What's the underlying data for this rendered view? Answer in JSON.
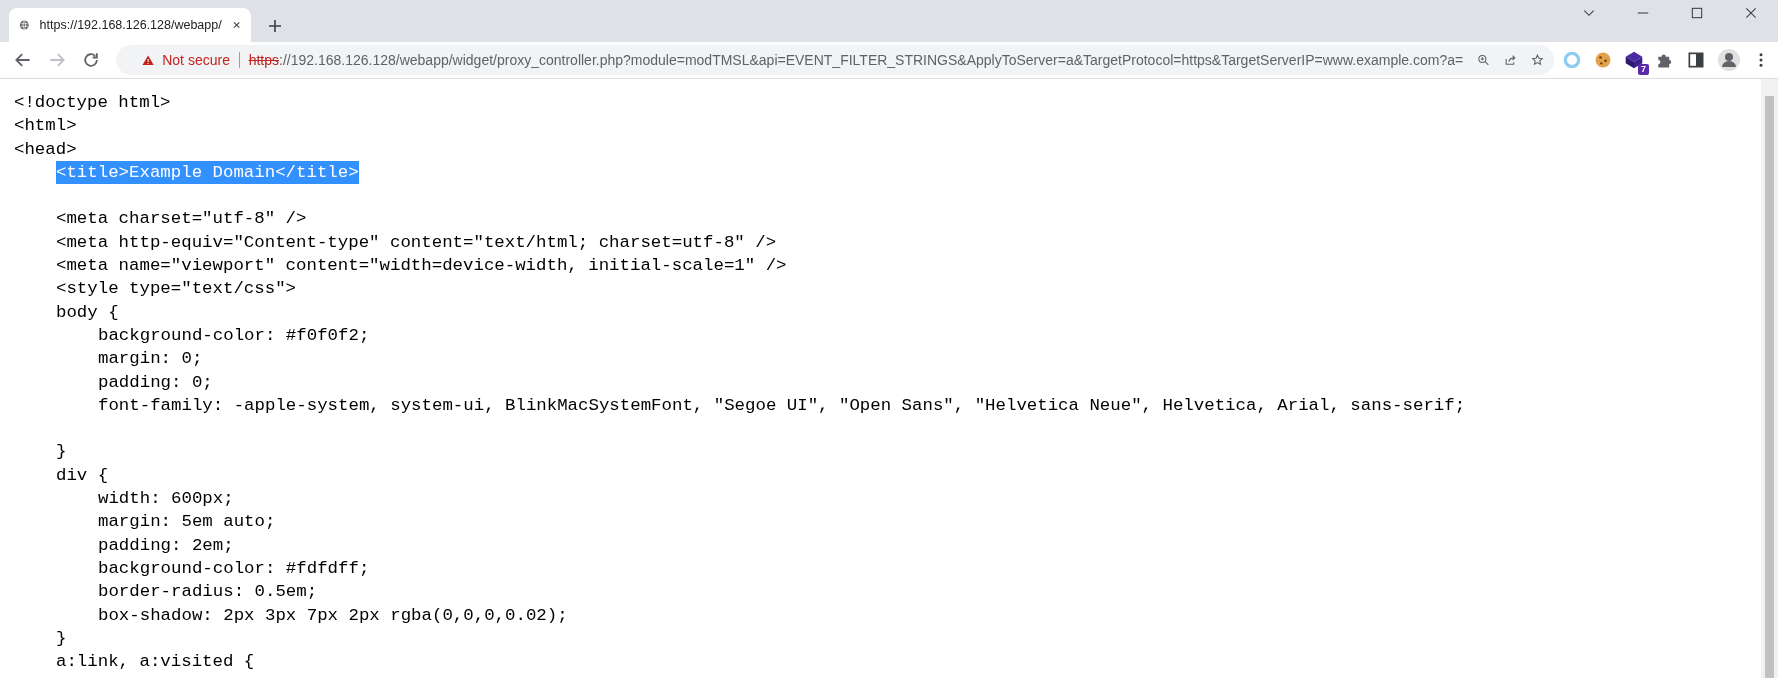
{
  "tab": {
    "title": "https://192.168.126.128/webapp/",
    "selected": true
  },
  "toolbar": {
    "forward_disabled": true
  },
  "address": {
    "security": "Not secure",
    "scheme": "https",
    "rest": "://192.168.126.128/webapp/widget/proxy_controller.php?module=modTMSL&api=EVENT_FILTER_STRINGS&ApplyToServer=a&TargetProtocol=https&TargetServerIP=www.example.com?a="
  },
  "extensions": {
    "badge": "7"
  },
  "source_lines": [
    {
      "kind": "code",
      "text": "<!doctype html>",
      "highlighted": false
    },
    {
      "kind": "code",
      "text": "<html>",
      "highlighted": false
    },
    {
      "kind": "code",
      "text": "<head>",
      "highlighted": false,
      "children": [
        {
          "kind": "code",
          "text": "<title>Example Domain</title>",
          "highlighted": true
        },
        {
          "kind": "blank"
        },
        {
          "kind": "code",
          "text": "<meta charset=\"utf-8\" />",
          "highlighted": false
        },
        {
          "kind": "code",
          "text": "<meta http-equiv=\"Content-type\" content=\"text/html; charset=utf-8\" />",
          "highlighted": false
        },
        {
          "kind": "code",
          "text": "<meta name=\"viewport\" content=\"width=device-width, initial-scale=1\" />",
          "highlighted": false
        },
        {
          "kind": "code",
          "text": "<style type=\"text/css\">",
          "highlighted": false
        },
        {
          "kind": "code",
          "text": "body {",
          "highlighted": false,
          "children": [
            {
              "kind": "code",
              "text": "background-color: #f0f0f2;",
              "highlighted": false
            },
            {
              "kind": "code",
              "text": "margin: 0;",
              "highlighted": false
            },
            {
              "kind": "code",
              "text": "padding: 0;",
              "highlighted": false
            },
            {
              "kind": "code",
              "text": "font-family: -apple-system, system-ui, BlinkMacSystemFont, \"Segoe UI\", \"Open Sans\", \"Helvetica Neue\", Helvetica, Arial, sans-serif;",
              "highlighted": false
            },
            {
              "kind": "blank"
            }
          ]
        },
        {
          "kind": "code",
          "text": "}",
          "highlighted": false
        },
        {
          "kind": "code",
          "text": "div {",
          "highlighted": false,
          "children": [
            {
              "kind": "code",
              "text": "width: 600px;",
              "highlighted": false
            },
            {
              "kind": "code",
              "text": "margin: 5em auto;",
              "highlighted": false
            },
            {
              "kind": "code",
              "text": "padding: 2em;",
              "highlighted": false
            },
            {
              "kind": "code",
              "text": "background-color: #fdfdff;",
              "highlighted": false
            },
            {
              "kind": "code",
              "text": "border-radius: 0.5em;",
              "highlighted": false
            },
            {
              "kind": "code",
              "text": "box-shadow: 2px 3px 7px 2px rgba(0,0,0,0.02);",
              "highlighted": false
            }
          ]
        },
        {
          "kind": "code",
          "text": "}",
          "highlighted": false
        },
        {
          "kind": "code",
          "text": "a:link, a:visited {",
          "highlighted": false
        }
      ]
    }
  ]
}
